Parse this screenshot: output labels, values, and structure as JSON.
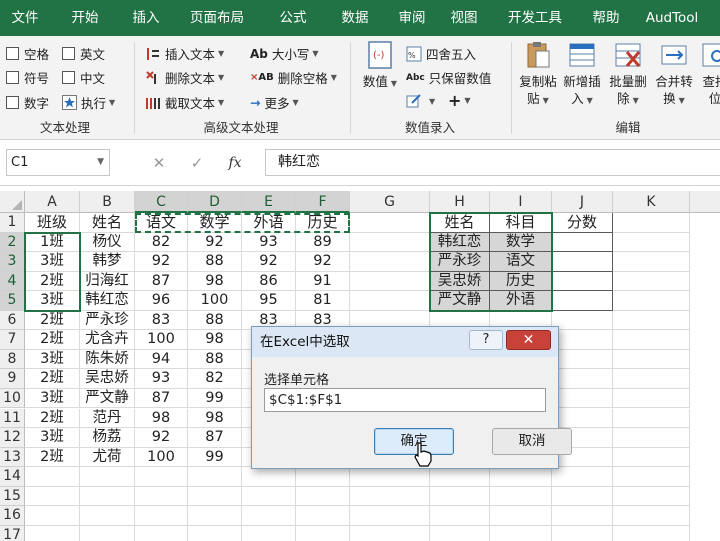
{
  "tabs": [
    "文件",
    "开始",
    "插入",
    "页面布局",
    "公式",
    "数据",
    "审阅",
    "视图",
    "开发工具",
    "帮助",
    "AudTool"
  ],
  "ribbon": {
    "text_group": {
      "label": "文本处理",
      "items": [
        "空格",
        "英文",
        "符号",
        "中文",
        "数字",
        "执行"
      ]
    },
    "adv_group": {
      "label": "高级文本处理",
      "items": [
        "插入文本",
        "大小写",
        "删除文本",
        "删除空格",
        "截取文本",
        "更多"
      ]
    },
    "value_group": {
      "label": "数值录入",
      "big": "数值",
      "items": [
        "四舍五入",
        "只保留数值"
      ]
    },
    "edit_group": {
      "label": "编辑",
      "buttons": [
        {
          "l1": "复制粘",
          "l2": "贴"
        },
        {
          "l1": "新增插",
          "l2": "入"
        },
        {
          "l1": "批量删",
          "l2": "除"
        },
        {
          "l1": "合并转",
          "l2": "换"
        },
        {
          "l1": "查找",
          "l2": "位"
        }
      ]
    }
  },
  "formula_bar": {
    "name_box": "C1",
    "cancel": "✕",
    "confirm": "✓",
    "fx": "fx",
    "content": "韩红恋"
  },
  "sheet": {
    "columns": [
      "A",
      "B",
      "C",
      "D",
      "E",
      "F",
      "G",
      "H",
      "I",
      "J",
      "K"
    ],
    "rows": [
      "1",
      "2",
      "3",
      "4",
      "5",
      "6",
      "7",
      "8",
      "9",
      "10",
      "11",
      "12",
      "13",
      "14",
      "15",
      "16",
      "17"
    ],
    "table1": {
      "headers": [
        "班级",
        "姓名",
        "语文",
        "数学",
        "外语",
        "历史"
      ],
      "data": [
        [
          "1班",
          "杨仪",
          "82",
          "92",
          "93",
          "89"
        ],
        [
          "3班",
          "韩梦",
          "92",
          "88",
          "92",
          "92"
        ],
        [
          "2班",
          "归海红",
          "87",
          "98",
          "86",
          "91"
        ],
        [
          "3班",
          "韩红恋",
          "96",
          "100",
          "95",
          "81"
        ],
        [
          "2班",
          "严永珍",
          "83",
          "88",
          "83",
          "83"
        ],
        [
          "2班",
          "尤含卉",
          "100",
          "98",
          "",
          ""
        ],
        [
          "3班",
          "陈朱娇",
          "94",
          "88",
          "",
          ""
        ],
        [
          "2班",
          "吴忠娇",
          "93",
          "82",
          "",
          ""
        ],
        [
          "3班",
          "严文静",
          "87",
          "99",
          "",
          ""
        ],
        [
          "2班",
          "范丹",
          "98",
          "98",
          "",
          ""
        ],
        [
          "3班",
          "杨荔",
          "92",
          "87",
          "",
          ""
        ],
        [
          "2班",
          "尤荷",
          "100",
          "99",
          "",
          ""
        ]
      ]
    },
    "table2": {
      "headers": [
        "姓名",
        "科目",
        "分数"
      ],
      "data": [
        [
          "韩红恋",
          "数学",
          ""
        ],
        [
          "严永珍",
          "语文",
          ""
        ],
        [
          "吴忠娇",
          "历史",
          ""
        ],
        [
          "严文静",
          "外语",
          ""
        ]
      ]
    }
  },
  "dialog": {
    "title": "在Excel中选取",
    "help": "?",
    "close": "✕",
    "label": "选择单元格",
    "value": "$C$1:$F$1",
    "ok": "确定",
    "cancel": "取消"
  },
  "colors": {
    "excel_green": "#217346",
    "dialog_title_bg": "#dbe7f4",
    "close_red": "#c8423a",
    "selected_gray": "#d6d6d6"
  }
}
